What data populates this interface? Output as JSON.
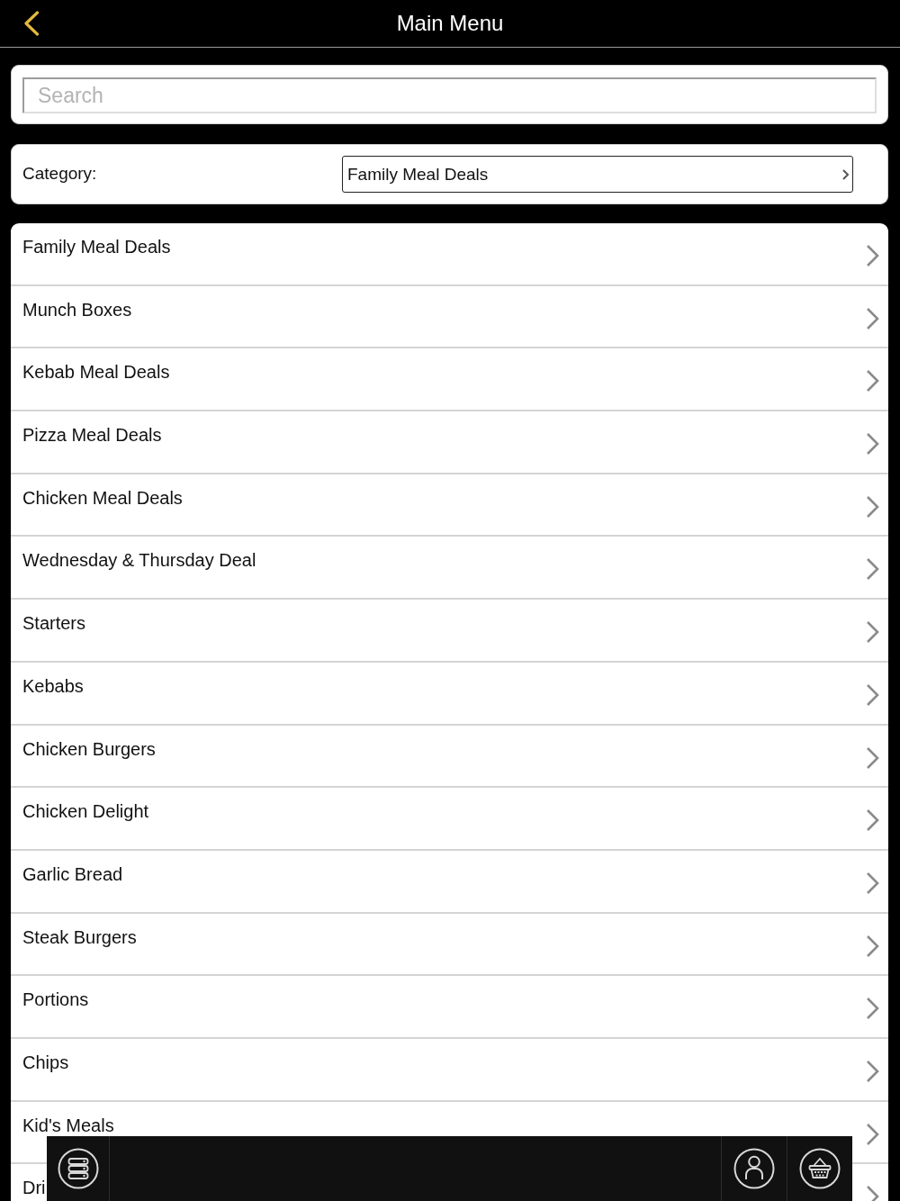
{
  "header": {
    "title": "Main Menu"
  },
  "search": {
    "placeholder": "Search"
  },
  "category": {
    "label": "Category:",
    "value": "Family Meal Deals"
  },
  "menu_items": [
    "Family Meal Deals",
    "Munch Boxes",
    "Kebab Meal Deals",
    "Pizza Meal Deals",
    "Chicken Meal Deals",
    "Wednesday & Thursday Deal",
    "Starters",
    "Kebabs",
    "Chicken Burgers",
    "Chicken Delight",
    "Garlic Bread",
    "Steak Burgers",
    "Portions",
    "Chips",
    "Kid's Meals",
    "Dri"
  ],
  "toolbar": {
    "buttons": [
      {
        "kind": "menu"
      },
      {
        "kind": "account"
      },
      {
        "kind": "basket"
      }
    ]
  }
}
